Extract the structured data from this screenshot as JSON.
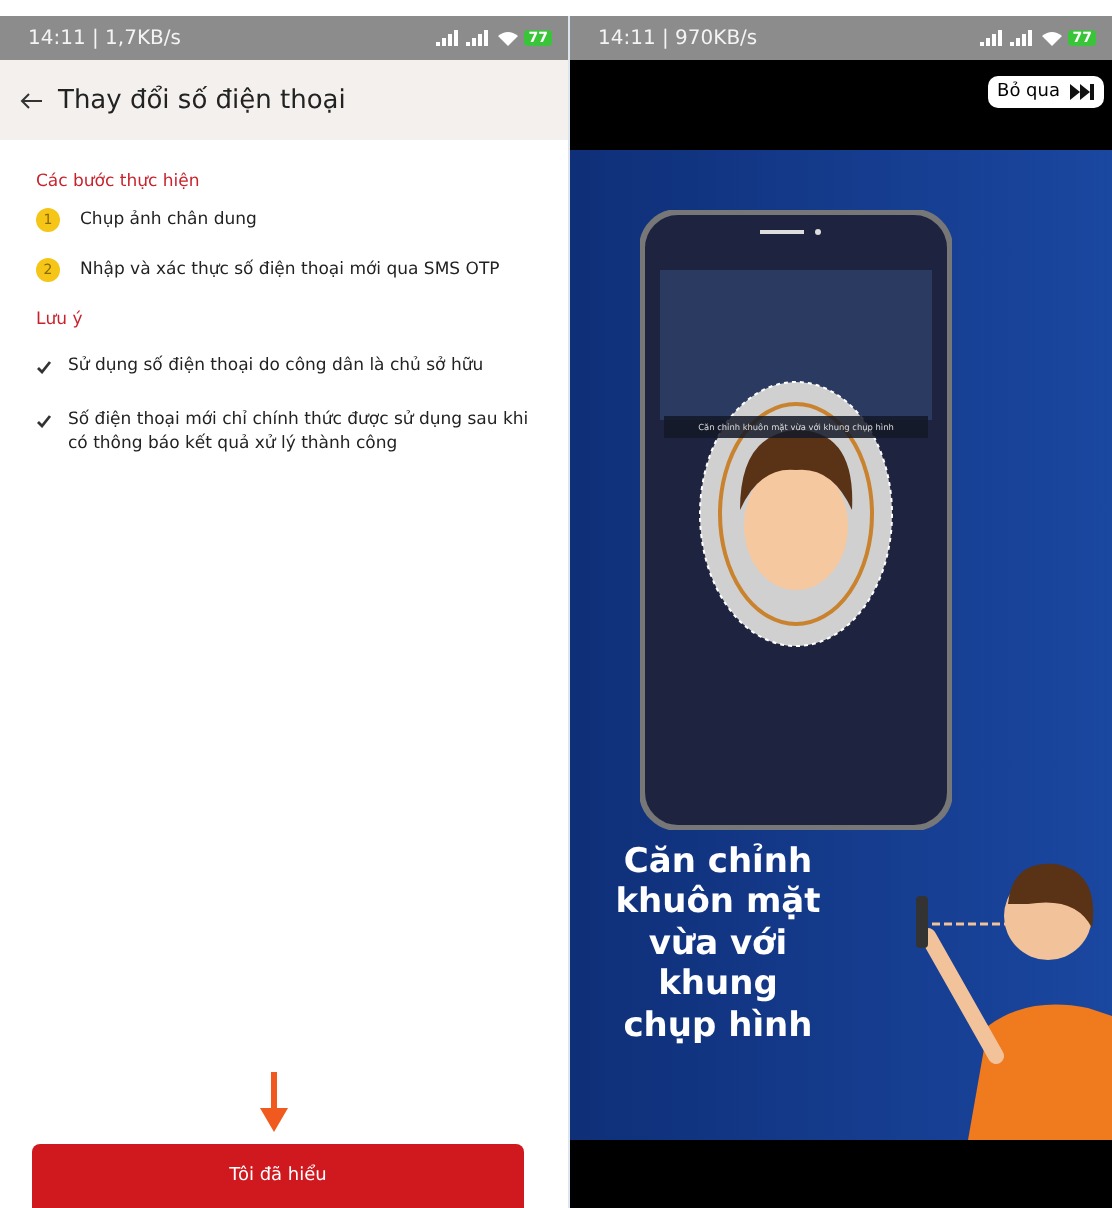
{
  "left_screen": {
    "status_bar": {
      "time": "14:11 | 1,7KB/s",
      "battery": "77"
    },
    "header": {
      "title": "Thay đổi số điện thoại"
    },
    "steps_title": "Các bước thực hiện",
    "steps": [
      {
        "number": "1",
        "text": "Chụp ảnh chân dung"
      },
      {
        "number": "2",
        "text": "Nhập và xác thực số điện thoại mới qua SMS OTP"
      }
    ],
    "notes_title": "Lưu ý",
    "notes": [
      "Sử dụng số điện thoại do công dân là chủ sở hữu",
      "Số điện thoại mới chỉ chính thức được sử dụng sau khi có thông báo kết quả xử lý thành công"
    ],
    "button": "Tôi đã hiểu"
  },
  "right_screen": {
    "status_bar": {
      "time": "14:11 | 970KB/s",
      "battery": "77"
    },
    "skip_button": "Bỏ qua",
    "phone_prompt": "Căn chỉnh khuôn mặt vừa với khung chụp hình",
    "caption": "Căn chỉnh\nkhuôn mặt\nvừa với\nkhung\nchụp hình"
  }
}
